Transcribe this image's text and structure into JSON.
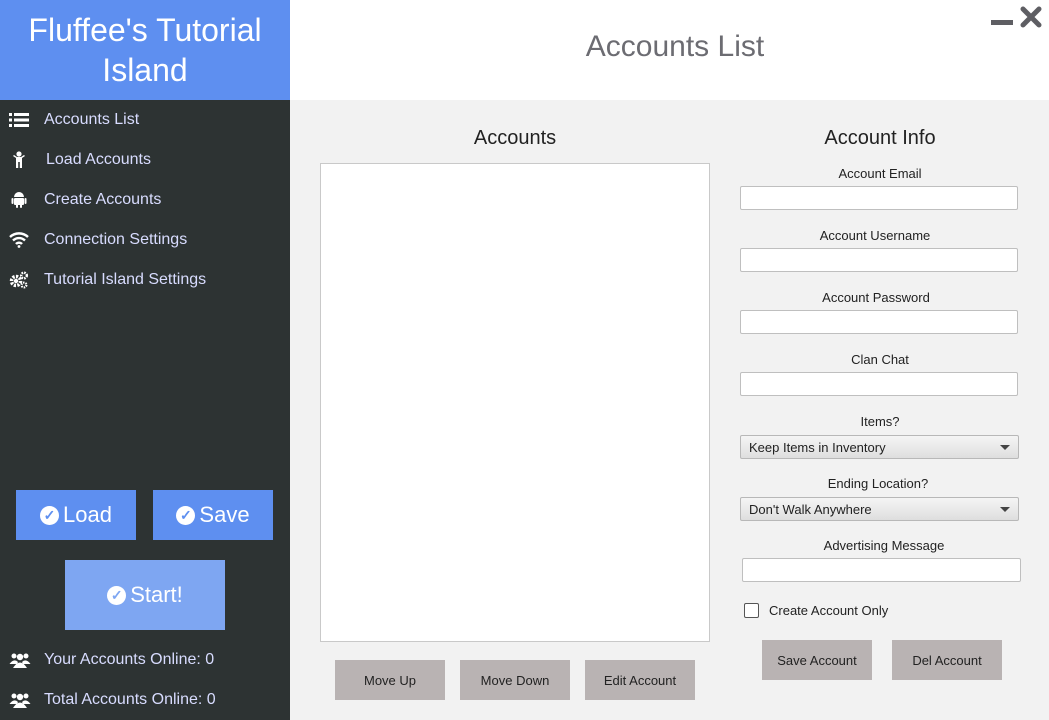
{
  "sidebar": {
    "brand": "Fluffee's Tutorial Island",
    "nav": [
      {
        "label": "Accounts List",
        "icon": "list-icon"
      },
      {
        "label": "Load Accounts",
        "icon": "person-icon"
      },
      {
        "label": "Create Accounts",
        "icon": "android-icon"
      },
      {
        "label": "Connection Settings",
        "icon": "wifi-icon"
      },
      {
        "label": "Tutorial Island Settings",
        "icon": "gears-icon"
      }
    ],
    "load_label": "Load",
    "save_label": "Save",
    "start_label": "Start!",
    "your_accounts": "Your Accounts Online: 0",
    "total_accounts": "Total Accounts Online: 0"
  },
  "header": {
    "title": "Accounts List"
  },
  "accounts": {
    "title": "Accounts",
    "move_up": "Move Up",
    "move_down": "Move Down",
    "edit": "Edit Account"
  },
  "info": {
    "title": "Account Info",
    "email_label": "Account Email",
    "email_value": "",
    "username_label": "Account Username",
    "username_value": "",
    "password_label": "Account Password",
    "password_value": "",
    "clan_label": "Clan Chat",
    "clan_value": "",
    "items_label": "Items?",
    "items_value": "Keep Items in Inventory",
    "ending_label": "Ending Location?",
    "ending_value": "Don't Walk Anywhere",
    "advert_label": "Advertising Message",
    "advert_value": "",
    "create_only_label": "Create Account Only",
    "create_only_checked": false,
    "save_button": "Save Account",
    "del_button": "Del Account"
  },
  "colors": {
    "accent": "#5e8ff0",
    "sidebar_bg": "#2d3333",
    "nav_text": "#d8dcff",
    "button_gray": "#b9b3b3"
  }
}
